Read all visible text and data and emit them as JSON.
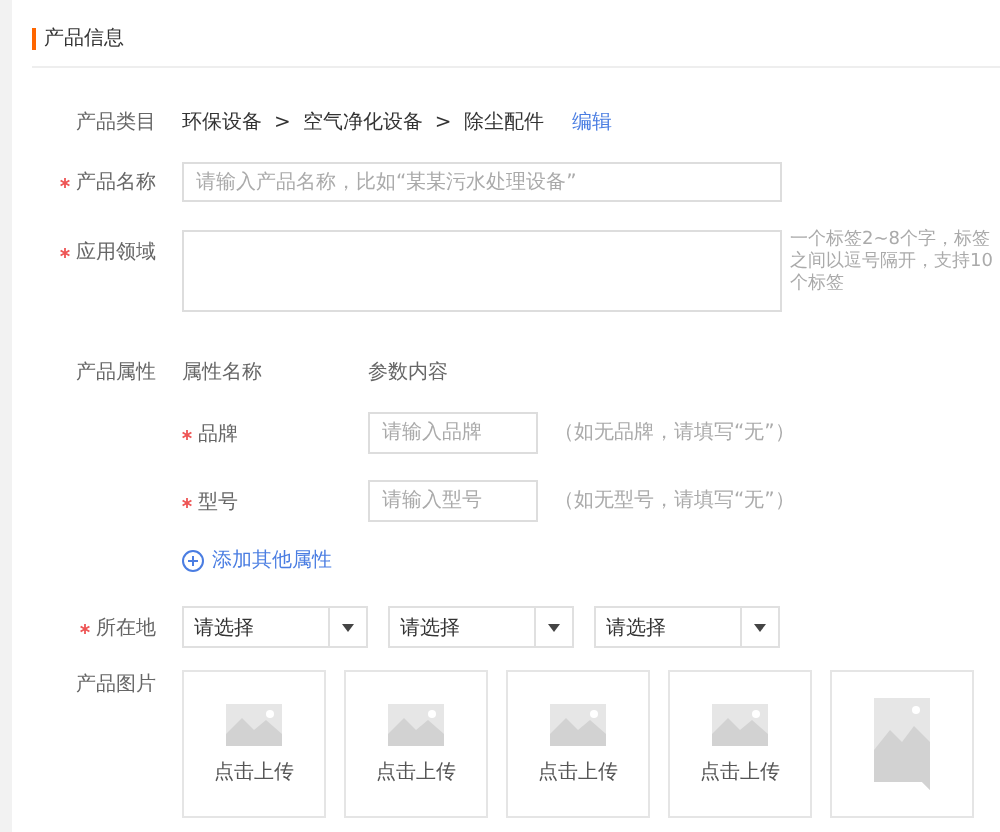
{
  "section_title": "产品信息",
  "category": {
    "label": "产品类目",
    "path": [
      "环保设备",
      ">",
      "空气净化设备",
      ">",
      "除尘配件"
    ],
    "edit_link": "编辑"
  },
  "product_name": {
    "label": "产品名称",
    "required": true,
    "placeholder": "请输入产品名称，比如“某某污水处理设备”"
  },
  "application": {
    "label": "应用领域",
    "required": true,
    "hint": "一个标签2~8个字，标签之间以逗号隔开，支持10个标签"
  },
  "attributes": {
    "label": "产品属性",
    "columns": [
      "属性名称",
      "参数内容"
    ],
    "rows": [
      {
        "name": "品牌",
        "required": true,
        "placeholder": "请输入品牌",
        "hint": "（如无品牌，请填写“无”）"
      },
      {
        "name": "型号",
        "required": true,
        "placeholder": "请输入型号",
        "hint": "（如无型号，请填写“无”）"
      }
    ],
    "add_link": "添加其他属性"
  },
  "location": {
    "label": "所在地",
    "required": true,
    "selects": [
      "请选择",
      "请选择",
      "请选择"
    ]
  },
  "images": {
    "label": "产品图片",
    "slots": [
      {
        "kind": "upload",
        "caption": "点击上传"
      },
      {
        "kind": "upload",
        "caption": "点击上传"
      },
      {
        "kind": "upload",
        "caption": "点击上传"
      },
      {
        "kind": "upload",
        "caption": "点击上传"
      },
      {
        "kind": "preview"
      }
    ]
  }
}
